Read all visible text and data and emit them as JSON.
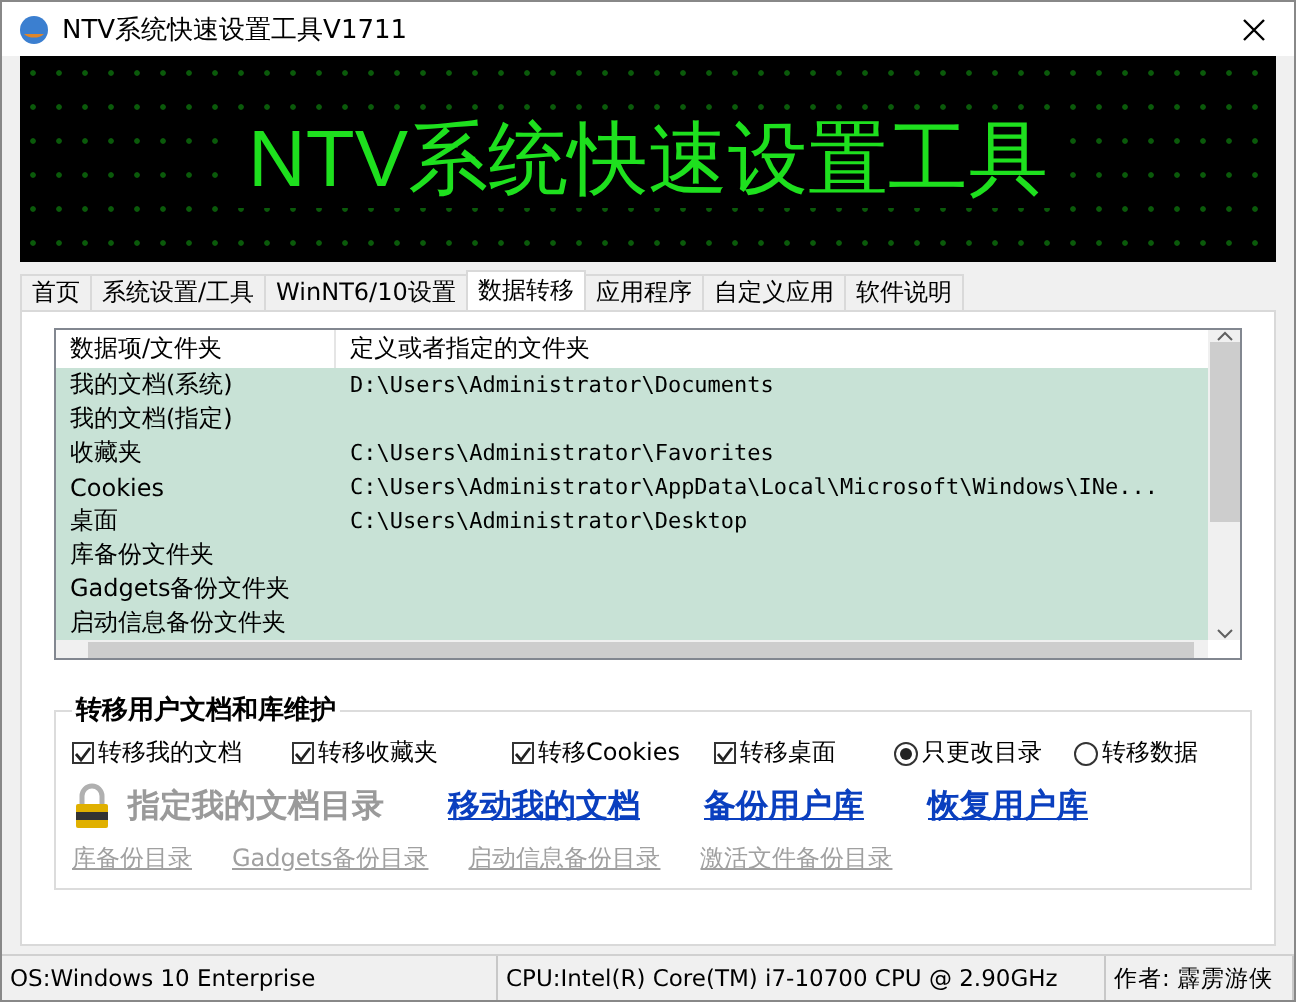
{
  "window": {
    "title": "NTV系统快速设置工具V1711"
  },
  "banner": {
    "title": "NTV系统快速设置工具"
  },
  "tabs": [
    {
      "label": "首页",
      "selected": false
    },
    {
      "label": "系统设置/工具",
      "selected": false
    },
    {
      "label": "WinNT6/10设置",
      "selected": false
    },
    {
      "label": "数据转移",
      "selected": true
    },
    {
      "label": "应用程序",
      "selected": false
    },
    {
      "label": "自定义应用",
      "selected": false
    },
    {
      "label": "软件说明",
      "selected": false
    }
  ],
  "table": {
    "columns": [
      "数据项/文件夹",
      "定义或者指定的文件夹"
    ],
    "rows": [
      {
        "item": "我的文档(系统)",
        "folder": "D:\\Users\\Administrator\\Documents"
      },
      {
        "item": "我的文档(指定)",
        "folder": ""
      },
      {
        "item": "收藏夹",
        "folder": "C:\\Users\\Administrator\\Favorites"
      },
      {
        "item": "Cookies",
        "folder": "C:\\Users\\Administrator\\AppData\\Local\\Microsoft\\Windows\\INe..."
      },
      {
        "item": "桌面",
        "folder": "C:\\Users\\Administrator\\Desktop"
      },
      {
        "item": "库备份文件夹",
        "folder": ""
      },
      {
        "item": "Gadgets备份文件夹",
        "folder": ""
      },
      {
        "item": "启动信息备份文件夹",
        "folder": ""
      }
    ]
  },
  "group": {
    "title": "转移用户文档和库维护",
    "options": [
      {
        "kind": "checkbox",
        "label": "转移我的文档",
        "checked": true
      },
      {
        "kind": "checkbox",
        "label": "转移收藏夹",
        "checked": true
      },
      {
        "kind": "checkbox",
        "label": "转移Cookies",
        "checked": true
      },
      {
        "kind": "checkbox",
        "label": "转移桌面",
        "checked": true
      },
      {
        "kind": "radio",
        "label": "只更改目录",
        "selected": true
      },
      {
        "kind": "radio",
        "label": "转移数据",
        "selected": false
      }
    ],
    "actions": [
      {
        "label": "指定我的文档目录",
        "disabled": true
      },
      {
        "label": "移动我的文档",
        "disabled": false
      },
      {
        "label": "备份用户库",
        "disabled": false
      },
      {
        "label": "恢复用户库",
        "disabled": false
      }
    ],
    "folder_links": [
      {
        "label": "库备份目录",
        "disabled": true
      },
      {
        "label": "Gadgets备份目录",
        "disabled": true
      },
      {
        "label": "启动信息备份目录",
        "disabled": true
      },
      {
        "label": "激活文件备份目录",
        "disabled": true
      }
    ]
  },
  "status_bar": [
    "OS:Windows 10 Enterprise",
    "CPU:Intel(R) Core(TM) i7-10700 CPU @ 2.90GHz",
    "作者: 霹雳游侠"
  ]
}
